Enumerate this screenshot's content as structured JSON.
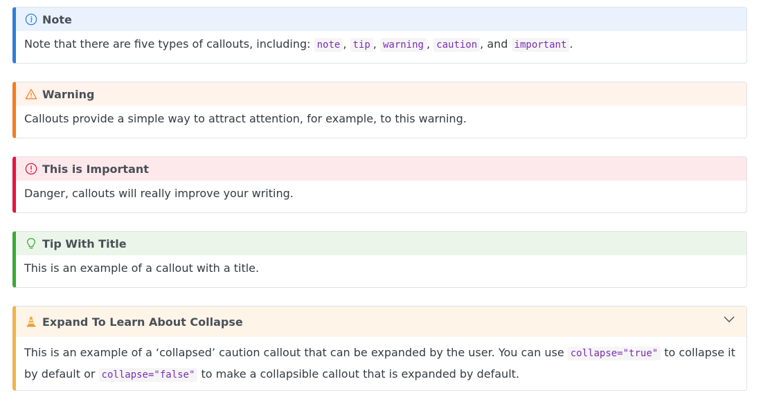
{
  "callouts": {
    "note": {
      "title": "Note",
      "text1": "Note that there are five types of callouts, including: ",
      "codes": [
        "note",
        "tip",
        "warning",
        "caution",
        "important"
      ],
      "sep1": ", ",
      "sep_and": ", and ",
      "end": ".",
      "icon": "info-circle-icon",
      "color": "#0d6efd",
      "bg": "#e7f1fe"
    },
    "warning": {
      "title": "Warning",
      "text": "Callouts provide a simple way to attract attention, for example, to this warning.",
      "icon": "warning-triangle-icon",
      "color": "#fd7e14",
      "bg": "#fff2e8"
    },
    "important": {
      "title": "This is Important",
      "text": "Danger, callouts will really improve your writing.",
      "icon": "exclamation-circle-icon",
      "color": "#dc3545",
      "bg": "#fde8ea"
    },
    "tip": {
      "title": "Tip With Title",
      "text": "This is an example of a callout with a title.",
      "icon": "lightbulb-icon",
      "color": "#198754",
      "bg": "#e9f4ec"
    },
    "caution": {
      "title": "Expand To Learn About Collapse",
      "text1": "This is an example of a ‘collapsed’ caution callout that can be expanded by the user. You can use ",
      "code1": "collapse=\"true\"",
      "text2": " to collapse it by default or ",
      "code2": "collapse=\"false\"",
      "text3": " to make a collapsible callout that is expanded by default.",
      "icon": "traffic-cone-icon",
      "color": "#ffc107",
      "bg": "#fff7ea"
    }
  }
}
